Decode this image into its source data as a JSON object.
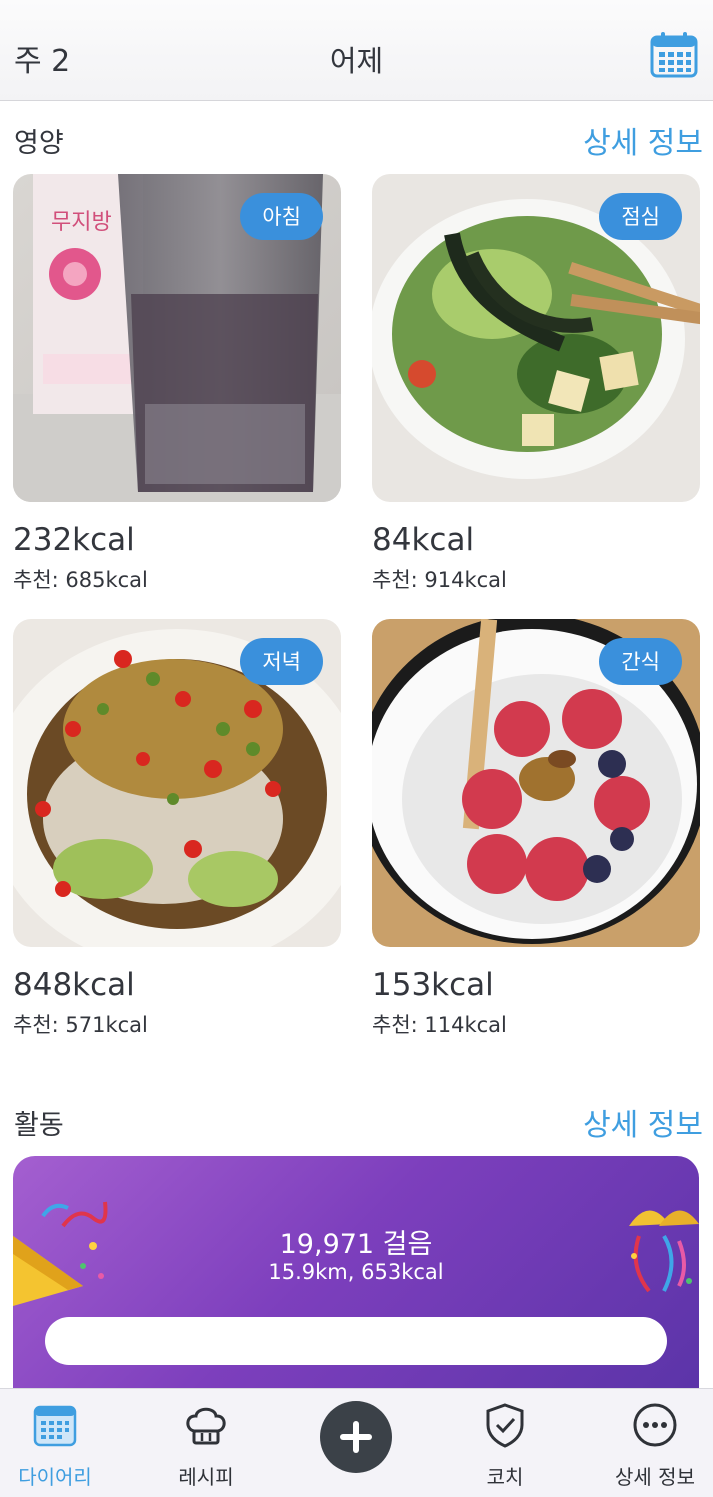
{
  "header": {
    "week": "주 2",
    "title": "어제"
  },
  "nutrition": {
    "title": "영양",
    "details_link": "상세 정보",
    "meals": [
      {
        "badge": "아침",
        "kcal": "232kcal",
        "recommend": "추천: 685kcal"
      },
      {
        "badge": "점심",
        "kcal": "84kcal",
        "recommend": "추천: 914kcal"
      },
      {
        "badge": "저녁",
        "kcal": "848kcal",
        "recommend": "추천: 571kcal"
      },
      {
        "badge": "간식",
        "kcal": "153kcal",
        "recommend": "추천: 114kcal"
      }
    ]
  },
  "activity": {
    "title": "활동",
    "details_link": "상세 정보",
    "steps": "19,971 걸음",
    "summary": "15.9km, 653kcal",
    "progress_fraction": 1.0
  },
  "tabbar": {
    "items": [
      {
        "label": "다이어리",
        "icon": "calendar-icon",
        "active": true
      },
      {
        "label": "레시피",
        "icon": "chef-hat-icon",
        "active": false
      },
      {
        "label": "",
        "icon": "plus-icon",
        "active": false
      },
      {
        "label": "코치",
        "icon": "shield-check-icon",
        "active": false
      },
      {
        "label": "상세 정보",
        "icon": "more-icon",
        "active": false
      }
    ]
  },
  "colors": {
    "accent": "#3f9ee0",
    "badge": "#3a90dc",
    "activity_start": "#a45fd0",
    "activity_end": "#5b34a8",
    "add_button": "#3b4148"
  }
}
